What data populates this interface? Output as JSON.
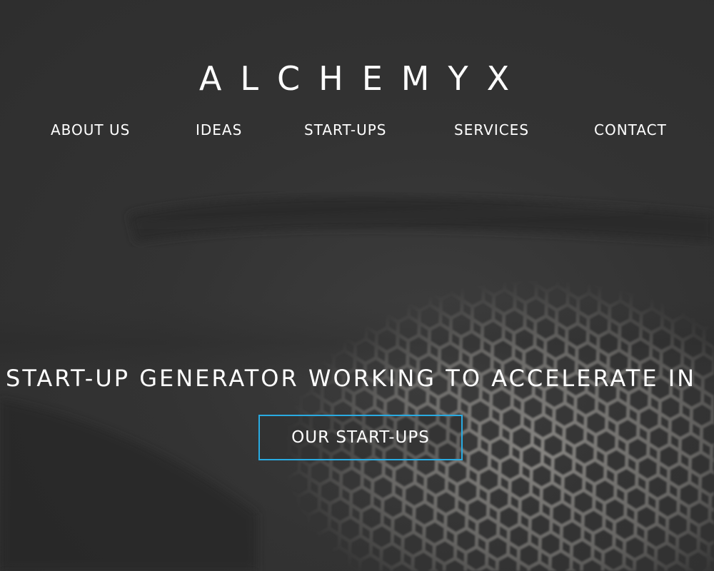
{
  "brand": {
    "logo_text": "ALCHEMYX"
  },
  "nav": {
    "items": [
      {
        "label": "ABOUT US"
      },
      {
        "label": "IDEAS"
      },
      {
        "label": "START-UPS"
      },
      {
        "label": "SERVICES"
      },
      {
        "label": "CONTACT"
      }
    ]
  },
  "hero": {
    "tagline": "START-UP GENERATOR WORKING TO ACCELERATE IN",
    "cta_label": "OUR START-UPS",
    "background_image": "3d-printed-mesh-photo"
  },
  "colors": {
    "background": "#333333",
    "text": "#ffffff",
    "accent_border": "#29abe2"
  }
}
